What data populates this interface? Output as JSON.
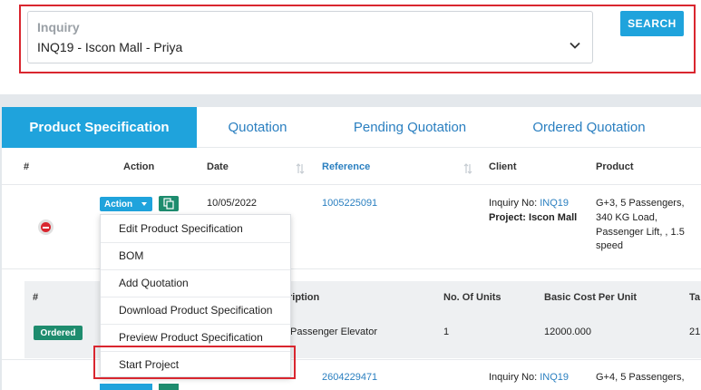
{
  "search": {
    "label": "Inquiry",
    "value": "INQ19 - Iscon Mall - Priya",
    "button": "SEARCH"
  },
  "tabs": [
    {
      "label": "Product Specification",
      "active": true
    },
    {
      "label": "Quotation",
      "active": false
    },
    {
      "label": "Pending Quotation",
      "active": false
    },
    {
      "label": "Ordered Quotation",
      "active": false
    }
  ],
  "table": {
    "headers": {
      "num": "#",
      "action": "Action",
      "date": "Date",
      "reference": "Reference",
      "client": "Client",
      "product": "Product"
    },
    "rows": [
      {
        "action_label": "Action",
        "date": "10/05/2022",
        "reference": "1005225091",
        "client_inquiry_prefix": "Inquiry No: ",
        "client_inquiry": "INQ19",
        "client_project": "Project: Iscon Mall",
        "product": [
          "G+3, 5 Passengers,",
          "340 KG Load,",
          "Passenger Lift, , 1.5",
          "speed"
        ]
      },
      {
        "reference": "2604229471",
        "client_inquiry_prefix": "Inquiry No: ",
        "client_inquiry": "INQ19",
        "product": [
          "G+4, 5 Passengers,"
        ]
      }
    ]
  },
  "subtable": {
    "headers": {
      "num": "#",
      "description": "ription",
      "units": "No. Of Units",
      "basic_cost": "Basic Cost Per Unit",
      "ta": "Ta"
    },
    "row": {
      "status": "Ordered",
      "description": "Passenger Elevator",
      "units": "1",
      "basic_cost": "12000.000",
      "ta": "21"
    }
  },
  "menu": {
    "items": [
      "Edit Product Specification",
      "BOM",
      "Add Quotation",
      "Download Product Specification",
      "Preview Product Specification",
      "Start Project"
    ]
  },
  "colors": {
    "accent": "#1fa3dc",
    "highlight": "#d9262f",
    "success": "#1e8c6e"
  }
}
